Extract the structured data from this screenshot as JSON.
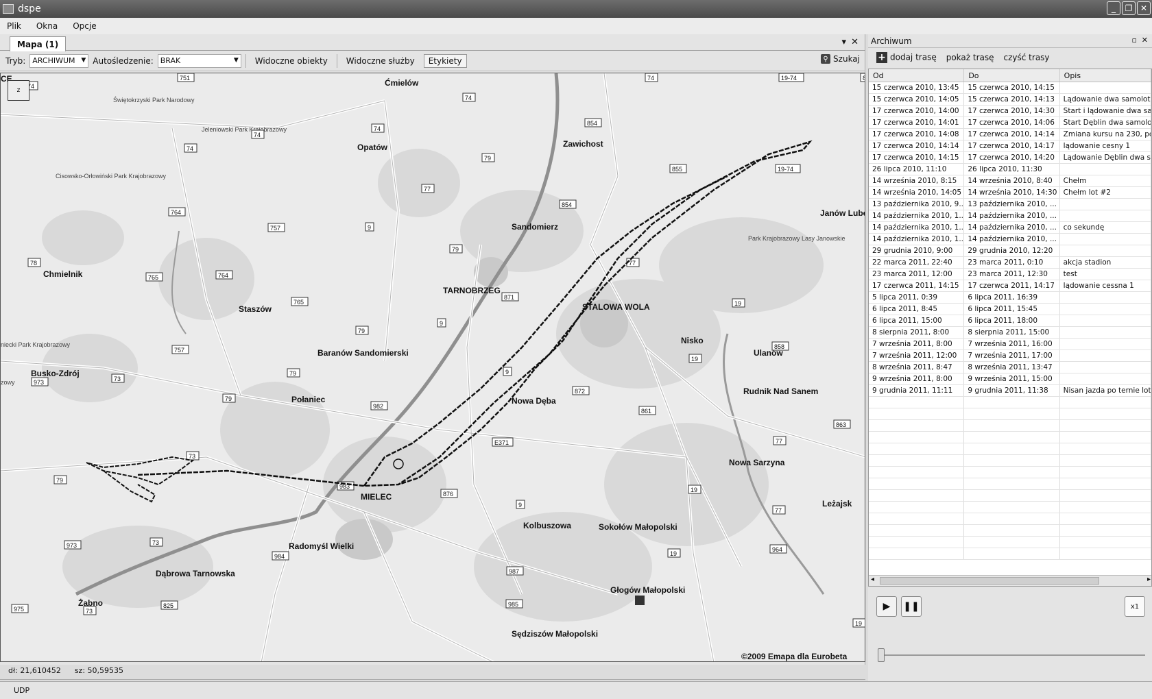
{
  "window": {
    "title": "dspe"
  },
  "menu": [
    "Plik",
    "Okna",
    "Opcje"
  ],
  "map_tab": {
    "label": "Mapa (1)"
  },
  "toolbar": {
    "mode_label": "Tryb:",
    "mode_value": "ARCHIWUM",
    "autotrack_label": "Autośledzenie:",
    "autotrack_value": "BRAK",
    "visible_objects": "Widoczne obiekty",
    "visible_services": "Widoczne służby",
    "labels": "Etykiety",
    "search": "Szukaj"
  },
  "map": {
    "zoom_button": "z",
    "copyright": "©2009 Emapa dla Eurobeta",
    "places": [
      {
        "name": "Ćmielów",
        "bold": true
      },
      {
        "name": "Opatów",
        "bold": true
      },
      {
        "name": "Zawichost",
        "bold": true
      },
      {
        "name": "Sandomierz",
        "bold": true
      },
      {
        "name": "Janów Lube",
        "bold": true
      },
      {
        "name": "Chmielnik",
        "bold": true
      },
      {
        "name": "Staszów",
        "bold": true
      },
      {
        "name": "TARNOBRZEG",
        "bold": true
      },
      {
        "name": "STALOWA WOLA",
        "bold": true
      },
      {
        "name": "Nisko",
        "bold": true
      },
      {
        "name": "Ulanów",
        "bold": true
      },
      {
        "name": "Baranów Sandomierski",
        "bold": true
      },
      {
        "name": "Busko-Zdrój",
        "bold": true
      },
      {
        "name": "Połaniec",
        "bold": true
      },
      {
        "name": "Nowa Dęba",
        "bold": true
      },
      {
        "name": "Rudnik Nad Sanem",
        "bold": true
      },
      {
        "name": "Nowa Sarzyna",
        "bold": true
      },
      {
        "name": "MIELEC",
        "bold": true
      },
      {
        "name": "Leżajsk",
        "bold": true
      },
      {
        "name": "Kolbuszowa",
        "bold": true
      },
      {
        "name": "Sokołów Małopolski",
        "bold": true
      },
      {
        "name": "Radomyśl Wielki",
        "bold": true
      },
      {
        "name": "Dąbrowa Tarnowska",
        "bold": true
      },
      {
        "name": "Głogów Małopolski",
        "bold": true
      },
      {
        "name": "Żabno",
        "bold": true
      },
      {
        "name": "Sędziszów Małopolski",
        "bold": true
      },
      {
        "name": "Świętokrzyski Park Narodowy",
        "bold": false
      },
      {
        "name": "Jeleniowski Park Krajobrazowy",
        "bold": false
      },
      {
        "name": "Cisowsko-Orłowiński Park Krajobrazowy",
        "bold": false
      },
      {
        "name": "Park Krajobrazowy Lasy Janowskie",
        "bold": false
      },
      {
        "name": "niecki Park Krajobrazowy",
        "bold": false
      },
      {
        "name": "zowy",
        "bold": false
      },
      {
        "name": "CE",
        "bold": true
      }
    ],
    "road_shields": [
      "751",
      "74",
      "74",
      "74",
      "74",
      "74",
      "74",
      "854",
      "855",
      "19-74",
      "19-74",
      "79",
      "77",
      "9",
      "764",
      "757",
      "854",
      "79",
      "78",
      "765",
      "764",
      "765",
      "77",
      "871",
      "9",
      "19",
      "79",
      "757",
      "73",
      "79",
      "973",
      "79",
      "982",
      "9",
      "872",
      "861",
      "858",
      "19",
      "863",
      "E371",
      "77",
      "73",
      "79",
      "983",
      "876",
      "9",
      "19",
      "77",
      "973",
      "73",
      "984",
      "19",
      "877",
      "987",
      "985",
      "964",
      "975",
      "73",
      "825",
      "19"
    ]
  },
  "coords": {
    "lon_label": "dł:",
    "lon_value": "21,610452",
    "lat_label": "sz:",
    "lat_value": "50,59535"
  },
  "status": {
    "text": "UDP"
  },
  "archive": {
    "title": "Archiwum",
    "actions": {
      "add": "dodaj trasę",
      "show": "pokaż trasę",
      "clear": "czyść trasy"
    },
    "columns": [
      "Od",
      "Do",
      "Opis"
    ],
    "rows": [
      [
        "15 czerwca 2010, 13:45",
        "15 czerwca 2010, 14:15",
        ""
      ],
      [
        "15 czerwca 2010, 14:05",
        "15 czerwca 2010, 14:13",
        "Lądowanie dwa samoloty"
      ],
      [
        "17 czerwca 2010, 14:00",
        "17 czerwca 2010, 14:30",
        "Start i lądowanie dwa sam"
      ],
      [
        "17 czerwca 2010, 14:01",
        "17 czerwca 2010, 14:06",
        "Start Dęblin dwa samoloty"
      ],
      [
        "17 czerwca 2010, 14:08",
        "17 czerwca 2010, 14:14",
        "Zmiana kursu na 230, potw"
      ],
      [
        "17 czerwca 2010, 14:14",
        "17 czerwca 2010, 14:17",
        "lądowanie cesny 1"
      ],
      [
        "17 czerwca 2010, 14:15",
        "17 czerwca 2010, 14:20",
        "Lądowanie Dęblin dwa sam"
      ],
      [
        "26 lipca 2010, 11:10",
        "26 lipca 2010, 11:30",
        ""
      ],
      [
        "14 września 2010, 8:15",
        "14 września 2010, 8:40",
        "Chełm"
      ],
      [
        "14 września 2010, 14:05",
        "14 września 2010, 14:30",
        "Chełm lot #2"
      ],
      [
        "13 października 2010, 9...",
        "13 października 2010, ...",
        ""
      ],
      [
        "14 października 2010, 1...",
        "14 października 2010, ...",
        ""
      ],
      [
        "14 października 2010, 1...",
        "14 października 2010, ...",
        "co sekundę"
      ],
      [
        "14 października 2010, 1...",
        "14 października 2010, ...",
        ""
      ],
      [
        "29 grudnia 2010, 9:00",
        "29 grudnia 2010, 12:20",
        ""
      ],
      [
        "22 marca 2011, 22:40",
        "23 marca 2011, 0:10",
        "akcja stadion"
      ],
      [
        "23 marca 2011, 12:00",
        "23 marca 2011, 12:30",
        "test"
      ],
      [
        "17 czerwca 2011, 14:15",
        "17 czerwca 2011, 14:17",
        "lądowanie cessna 1"
      ],
      [
        "5 lipca 2011, 0:39",
        "6 lipca 2011, 16:39",
        ""
      ],
      [
        "6 lipca 2011, 8:45",
        "6 lipca 2011, 15:45",
        ""
      ],
      [
        "6 lipca 2011, 15:00",
        "6 lipca 2011, 18:00",
        ""
      ],
      [
        "8 sierpnia 2011, 8:00",
        "8 sierpnia 2011, 15:00",
        ""
      ],
      [
        "7 września 2011, 8:00",
        "7 września 2011, 16:00",
        ""
      ],
      [
        "7 września 2011, 12:00",
        "7 września 2011, 17:00",
        ""
      ],
      [
        "8 września 2011, 8:47",
        "8 września 2011, 13:47",
        ""
      ],
      [
        "9 września 2011, 8:00",
        "9 września 2011, 15:00",
        ""
      ],
      [
        "9 grudnia 2011, 11:11",
        "9 grudnia 2011, 11:38",
        "Nisan jazda po ternie lotn"
      ]
    ],
    "empty_rows": 14,
    "speed": "x1"
  }
}
